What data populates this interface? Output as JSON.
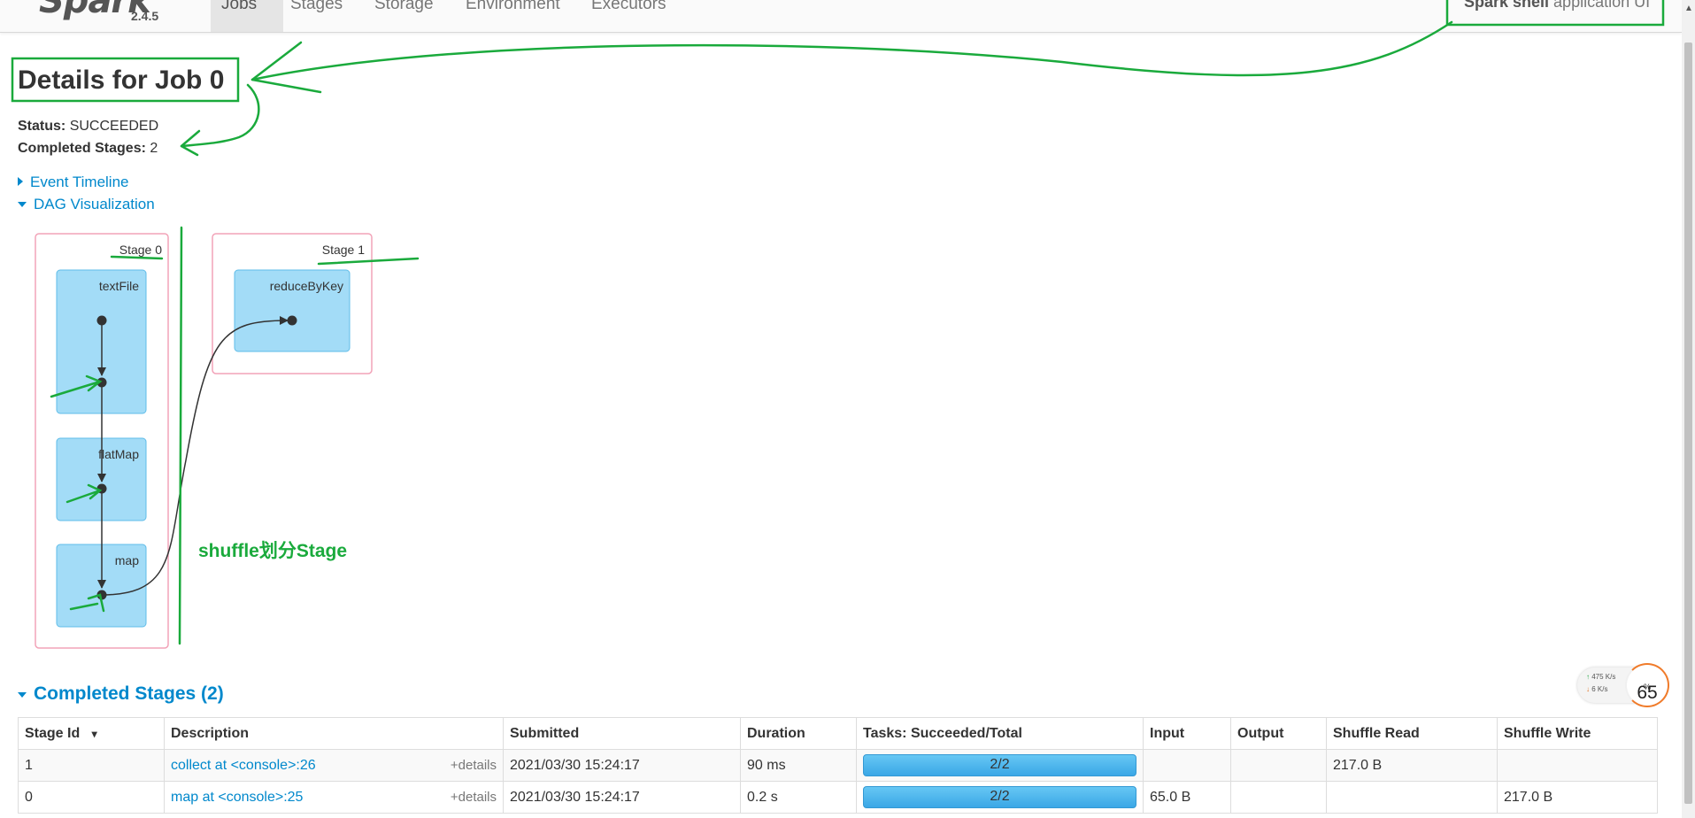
{
  "nav": {
    "brand": "Spark",
    "version": "2.4.5",
    "tabs": [
      "Jobs",
      "Stages",
      "Storage",
      "Environment",
      "Executors"
    ],
    "active_tab": "Jobs",
    "app_name_bold": "Spark shell",
    "app_name_rest": " application UI"
  },
  "page": {
    "title": "Details for Job 0",
    "status_label": "Status:",
    "status_value": "SUCCEEDED",
    "completed_stages_label": "Completed Stages:",
    "completed_stages_value": "2",
    "event_timeline": "Event Timeline",
    "dag_visualization": "DAG Visualization"
  },
  "dag": {
    "stages": [
      {
        "label": "Stage 0",
        "ops": [
          "textFile",
          "flatMap",
          "map"
        ]
      },
      {
        "label": "Stage 1",
        "ops": [
          "reduceByKey"
        ]
      }
    ],
    "annotation": "shuffle划分Stage"
  },
  "completed_stages": {
    "heading": "Completed Stages (2)",
    "columns": [
      "Stage Id",
      "Description",
      "Submitted",
      "Duration",
      "Tasks: Succeeded/Total",
      "Input",
      "Output",
      "Shuffle Read",
      "Shuffle Write"
    ],
    "sort_indicator": "▾",
    "details_label": "+details",
    "rows": [
      {
        "id": "1",
        "description": "collect at <console>:26",
        "submitted": "2021/03/30 15:24:17",
        "duration": "90 ms",
        "tasks": "2/2",
        "tasks_fraction": 1.0,
        "input": "",
        "output": "",
        "shuffle_read": "217.0 B",
        "shuffle_write": ""
      },
      {
        "id": "0",
        "description": "map at <console>:25",
        "submitted": "2021/03/30 15:24:17",
        "duration": "0.2 s",
        "tasks": "2/2",
        "tasks_fraction": 1.0,
        "input": "65.0 B",
        "output": "",
        "shuffle_read": "",
        "shuffle_write": "217.0 B"
      }
    ]
  },
  "widget": {
    "upload": "475 K/s",
    "download": "6  K/s",
    "percent": "65",
    "percent_unit": "%"
  },
  "colors": {
    "accent": "#0088cc",
    "annotation_green": "#1aaa3c",
    "stage_border": "#f2a3b8",
    "op_fill": "#a3dcf7"
  }
}
